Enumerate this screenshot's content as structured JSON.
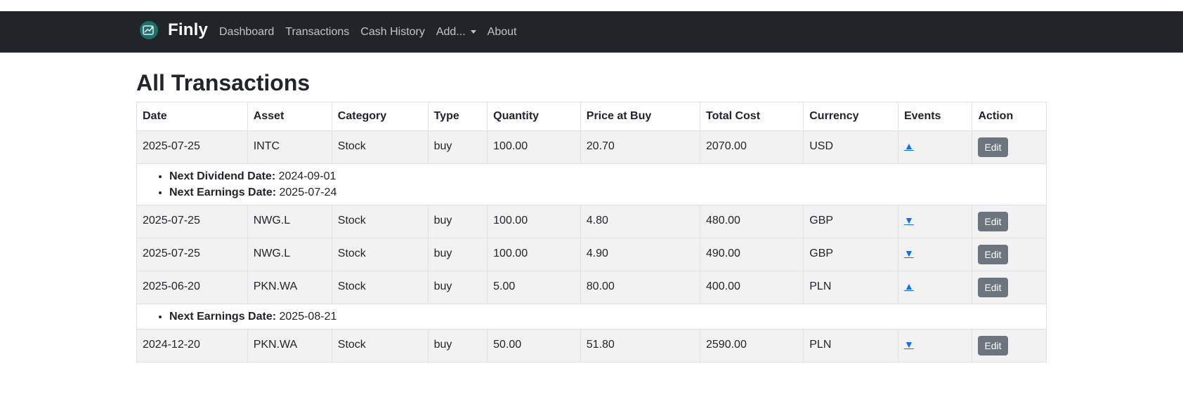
{
  "navbar": {
    "brand": "Finly",
    "links": [
      "Dashboard",
      "Transactions",
      "Cash History",
      "Add...",
      "About"
    ]
  },
  "page": {
    "title": "All Transactions"
  },
  "table": {
    "headers": [
      "Date",
      "Asset",
      "Category",
      "Type",
      "Quantity",
      "Price at Buy",
      "Total Cost",
      "Currency",
      "Events",
      "Action"
    ],
    "rows": [
      {
        "date": "2025-07-25",
        "asset": "INTC",
        "category": "Stock",
        "type": "buy",
        "quantity": "100.00",
        "price": "20.70",
        "total": "2070.00",
        "currency": "USD",
        "toggle": "▲",
        "action": "Edit"
      },
      {
        "date": "2025-07-25",
        "asset": "NWG.L",
        "category": "Stock",
        "type": "buy",
        "quantity": "100.00",
        "price": "4.80",
        "total": "480.00",
        "currency": "GBP",
        "toggle": "▼",
        "action": "Edit"
      },
      {
        "date": "2025-07-25",
        "asset": "NWG.L",
        "category": "Stock",
        "type": "buy",
        "quantity": "100.00",
        "price": "4.90",
        "total": "490.00",
        "currency": "GBP",
        "toggle": "▼",
        "action": "Edit"
      },
      {
        "date": "2025-06-20",
        "asset": "PKN.WA",
        "category": "Stock",
        "type": "buy",
        "quantity": "5.00",
        "price": "80.00",
        "total": "400.00",
        "currency": "PLN",
        "toggle": "▲",
        "action": "Edit"
      },
      {
        "date": "2024-12-20",
        "asset": "PKN.WA",
        "category": "Stock",
        "type": "buy",
        "quantity": "50.00",
        "price": "51.80",
        "total": "2590.00",
        "currency": "PLN",
        "toggle": "▼",
        "action": "Edit"
      }
    ],
    "events": {
      "intc": [
        {
          "label": "Next Dividend Date:",
          "value": "2024-09-01"
        },
        {
          "label": "Next Earnings Date:",
          "value": "2025-07-24"
        }
      ],
      "pkn": [
        {
          "label": "Next Earnings Date:",
          "value": "2025-08-21"
        }
      ]
    }
  },
  "colors": {
    "navbar_bg": "#212529",
    "logo_bg": "#1f6f6a",
    "row_bg": "#f2f2f2",
    "edit_button_bg": "#6c757d",
    "toggle_link": "#0d6efd"
  }
}
